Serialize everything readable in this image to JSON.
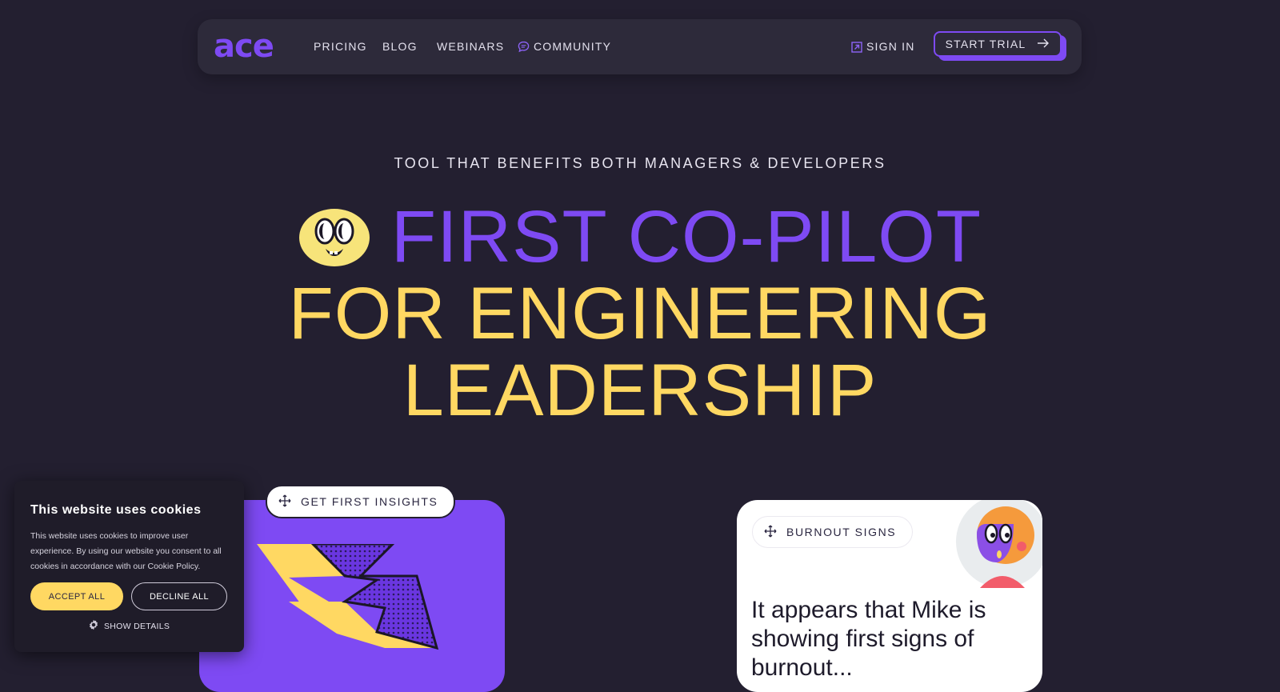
{
  "brand": {
    "logo_text": "ace",
    "accent": "#7e4af3",
    "yellow": "#ffd862",
    "bg": "#231f30"
  },
  "nav": {
    "items": [
      {
        "label": "PRICING"
      },
      {
        "label": "BLOG"
      },
      {
        "label": "WEBINARS"
      },
      {
        "label": "COMMUNITY",
        "icon": "chat-bubble-icon"
      }
    ],
    "sign_in": {
      "label": "SIGN IN",
      "icon": "external-link-icon"
    },
    "start_trial": {
      "label": "START TRIAL",
      "icon": "arrow-right-icon"
    }
  },
  "hero": {
    "eyebrow": "TOOL THAT BENEFITS BOTH MANAGERS & DEVELOPERS",
    "line1": "FIRST CO-PILOT",
    "line2": "FOR ENGINEERING",
    "line3": "LEADERSHIP",
    "mascot_icon": "smiley-face-icon"
  },
  "cards": {
    "insights": {
      "tag_label": "GET FIRST INSIGHTS",
      "tag_icon": "move-arrows-icon",
      "illustration": "lightning-bolt-icon"
    },
    "burnout": {
      "tag_label": "BURNOUT SIGNS",
      "tag_icon": "move-arrows-icon",
      "text": "It appears that Mike is showing first signs of burnout...",
      "avatar_icon": "character-avatar-icon"
    }
  },
  "cookie_banner": {
    "title": "This website uses cookies",
    "body": "This website uses cookies to improve user experience. By using our website you consent to all cookies in accordance with our Cookie Policy.",
    "accept_label": "ACCEPT ALL",
    "decline_label": "DECLINE ALL",
    "details_label": "SHOW DETAILS",
    "details_icon": "gear-icon"
  }
}
